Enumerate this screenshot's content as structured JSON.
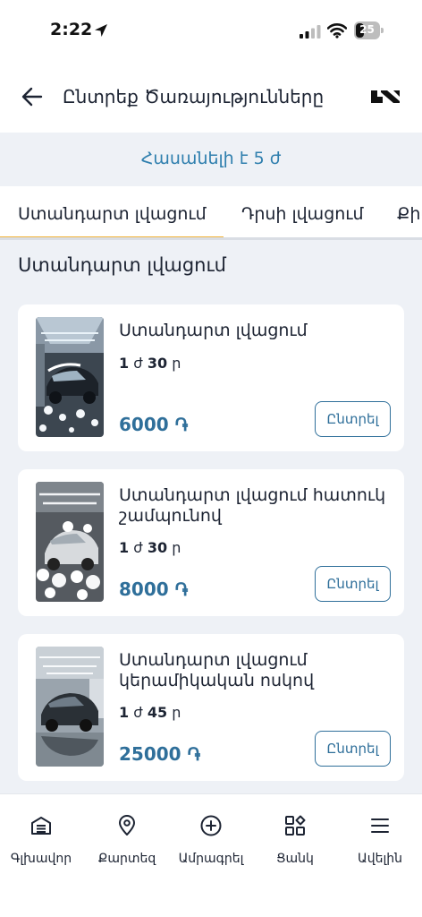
{
  "status_bar": {
    "time": "2:22",
    "battery": "25"
  },
  "header": {
    "title": "Ընտրեք Ծառայությունները"
  },
  "availability": "Հասանելի է 5 ժ",
  "tabs": [
    {
      "label": "Ստանդարտ լվացում",
      "active": true
    },
    {
      "label": "Դրսի լվացում",
      "active": false
    },
    {
      "label": "Քիմ",
      "active": false
    }
  ],
  "section_title": "Ստանդարտ լվացում",
  "services": [
    {
      "name": "Ստանդարտ լվացում",
      "duration_h": "1",
      "duration_h_unit": "ժ",
      "duration_m": "30",
      "duration_m_unit": "ր",
      "price": "6000 ֏",
      "button": "Ընտրել"
    },
    {
      "name": "Ստանդարտ լվացում հատուկ շամպունով",
      "duration_h": "1",
      "duration_h_unit": "ժ",
      "duration_m": "30",
      "duration_m_unit": "ր",
      "price": "8000 ֏",
      "button": "Ընտրել"
    },
    {
      "name": "Ստանդարտ լվացում կերամիկական ոսկով",
      "duration_h": "1",
      "duration_h_unit": "ժ",
      "duration_m": "45",
      "duration_m_unit": "ր",
      "price": "25000 ֏",
      "button": "Ընտրել"
    }
  ],
  "bottom_nav": [
    {
      "label": "Գլխավոր",
      "icon": "garage-icon"
    },
    {
      "label": "Քարտեզ",
      "icon": "map-pin-icon"
    },
    {
      "label": "Ամրագրել",
      "icon": "plus-circle-icon"
    },
    {
      "label": "Ցանկ",
      "icon": "category-grid-icon"
    },
    {
      "label": "Ավելին",
      "icon": "menu-icon"
    }
  ],
  "colors": {
    "accent": "#2f6f9a",
    "tab_indicator": "#f2b33a",
    "background": "#eef1f6"
  }
}
